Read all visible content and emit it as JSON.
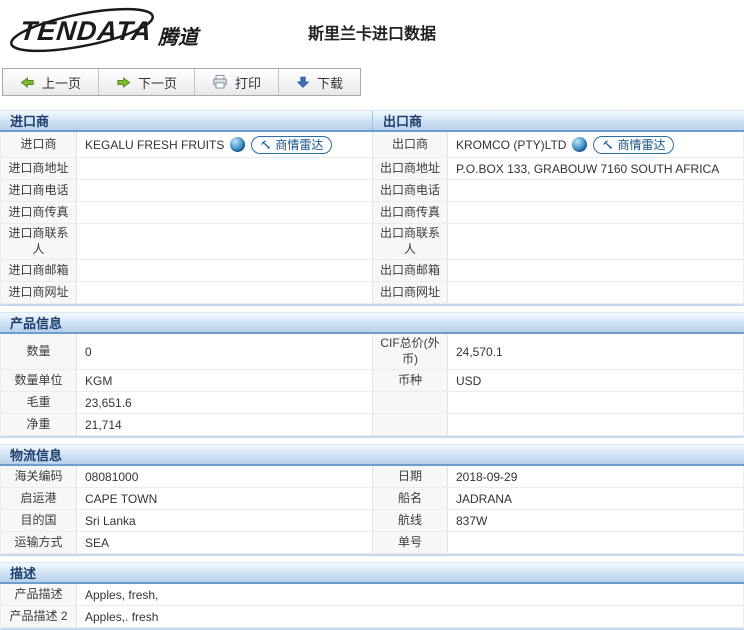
{
  "brand": {
    "logo_en": "TENDATA",
    "logo_cn": "腾道"
  },
  "page_title": "斯里兰卡进口数据",
  "toolbar": {
    "prev": "上一页",
    "next": "下一页",
    "print": "打印",
    "download": "下载"
  },
  "radar_button": "商情雷达",
  "icons": {
    "prev": "green-arrow-left",
    "next": "green-arrow-right",
    "print": "printer",
    "download": "blue-arrow-down",
    "company_link": "globe",
    "radar": "satellite-dish"
  },
  "colors": {
    "header_gradient_top": "#f3f9fd",
    "header_gradient_bottom": "#b7d2ec",
    "header_border": "#6f9cce",
    "header_text": "#1d3e6e",
    "label_cell_bg": "#f7f7f7",
    "radar_blue": "#2e6da4",
    "green_arrow": "#7cb832",
    "download_blue": "#3f6fc0"
  },
  "sections": [
    {
      "id": "trader",
      "left_header": "进口商",
      "right_header": "出口商",
      "rows": [
        {
          "left_label": "进口商",
          "left_value": "KEGALU FRESH FRUITS",
          "right_label": "出口商",
          "right_value": "KROMCO (PTY)LTD",
          "company": true
        },
        {
          "left_label": "进口商地址",
          "left_value": "",
          "right_label": "出口商地址",
          "right_value": "P.O.BOX 133, GRABOUW 7160 SOUTH AFRICA"
        },
        {
          "left_label": "进口商电话",
          "left_value": "",
          "right_label": "出口商电话",
          "right_value": ""
        },
        {
          "left_label": "进口商传真",
          "left_value": "",
          "right_label": "出口商传真",
          "right_value": ""
        },
        {
          "left_label": "进口商联系人",
          "left_value": "",
          "right_label": "出口商联系人",
          "right_value": ""
        },
        {
          "left_label": "进口商邮箱",
          "left_value": "",
          "right_label": "出口商邮箱",
          "right_value": ""
        },
        {
          "left_label": "进口商网址",
          "left_value": "",
          "right_label": "出口商网址",
          "right_value": ""
        }
      ]
    },
    {
      "id": "product",
      "header": "产品信息",
      "rows": [
        {
          "left_label": "数量",
          "left_value": "0",
          "right_label": "CIF总价(外币)",
          "right_value": "24,570.1"
        },
        {
          "left_label": "数量单位",
          "left_value": "KGM",
          "right_label": "币种",
          "right_value": "USD"
        },
        {
          "left_label": "毛重",
          "left_value": "23,651.6",
          "right_label": "",
          "right_value": ""
        },
        {
          "left_label": "净重",
          "left_value": "21,714",
          "right_label": "",
          "right_value": ""
        }
      ]
    },
    {
      "id": "logistics",
      "header": "物流信息",
      "rows": [
        {
          "left_label": "海关编码",
          "left_value": "08081000",
          "right_label": "日期",
          "right_value": "2018-09-29"
        },
        {
          "left_label": "启运港",
          "left_value": "CAPE TOWN",
          "right_label": "船名",
          "right_value": "JADRANA"
        },
        {
          "left_label": "目的国",
          "left_value": "Sri Lanka",
          "right_label": "航线",
          "right_value": "837W"
        },
        {
          "left_label": "运输方式",
          "left_value": "SEA",
          "right_label": "单号",
          "right_value": ""
        }
      ]
    },
    {
      "id": "description",
      "header": "描述",
      "rows": [
        {
          "label": "产品描述",
          "value": "Apples, fresh,"
        },
        {
          "label": "产品描述 2",
          "value": "Apples,. fresh"
        }
      ]
    }
  ]
}
